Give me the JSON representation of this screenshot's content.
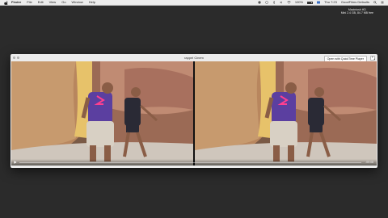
{
  "menubar": {
    "app_name": "Finder",
    "menus": [
      "File",
      "Edit",
      "View",
      "Go",
      "Window",
      "Help"
    ],
    "clock": "Thu 7:23",
    "user": "GoodFilms Defaults",
    "battery": "100%"
  },
  "desktop": {
    "volume_name": "Macintosh HD",
    "volume_detail": "Mini 2.4 GB, 84.7 MB free"
  },
  "window": {
    "title": "rappel Cinem",
    "open_button_label": "Open with QuickTime Player",
    "time_label": "-00:08",
    "progress": 0
  },
  "icons": {
    "apple": "apple-icon",
    "play": "play-icon",
    "fullscreen": "fullscreen-icon"
  }
}
